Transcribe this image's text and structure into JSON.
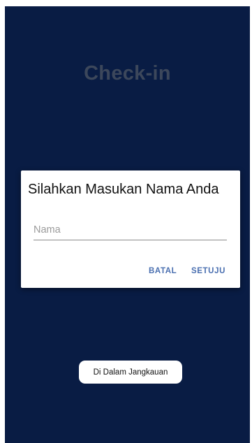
{
  "page": {
    "title": "Check-in"
  },
  "dialog": {
    "title": "Silahkan Masukan Nama Anda",
    "input": {
      "value": "",
      "placeholder": "Nama"
    },
    "cancel_label": "BATAL",
    "agree_label": "SETUJU"
  },
  "toast": {
    "message": "Di Dalam Jangkauan"
  },
  "colors": {
    "background": "#0a1e47",
    "title_text": "#3f4a5f",
    "accent": "#4a6fb0",
    "dialog_bg": "#ffffff"
  }
}
